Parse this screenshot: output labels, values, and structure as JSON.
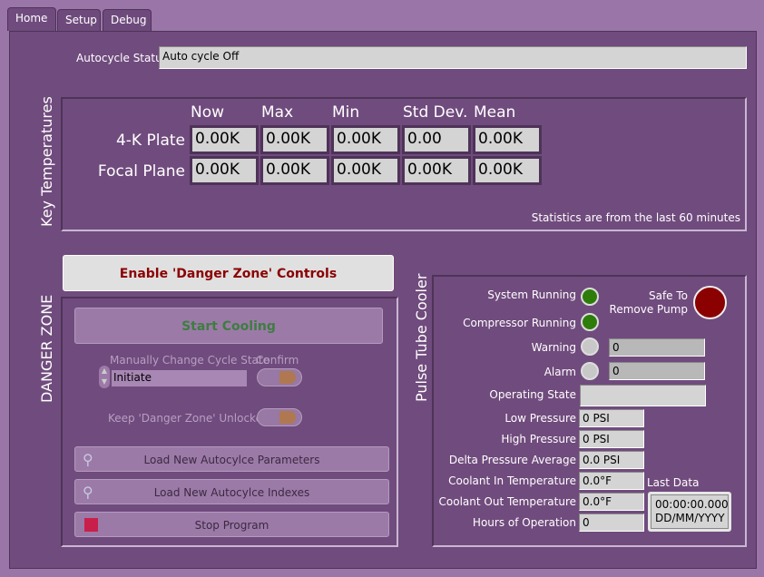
{
  "tabs": [
    {
      "label": "Home",
      "active": true
    },
    {
      "label": "Setup"
    },
    {
      "label": "Debug"
    }
  ],
  "autocycle": {
    "label": "Autocycle Status",
    "value": "Auto cycle Off"
  },
  "key_temps": {
    "title": "Key Temperatures",
    "columns": [
      "Now",
      "Max",
      "Min",
      "Std Dev.",
      "Mean"
    ],
    "rows": [
      {
        "label": "4-K Plate",
        "values": [
          "0.00K",
          "0.00K",
          "0.00K",
          "0.00",
          "0.00K"
        ]
      },
      {
        "label": "Focal Plane",
        "values": [
          "0.00K",
          "0.00K",
          "0.00K",
          "0.00K",
          "0.00K"
        ]
      }
    ],
    "note": "Statistics are from the last 60 minutes"
  },
  "danger": {
    "enable_label": "Enable 'Danger Zone' Controls",
    "title": "DANGER ZONE",
    "start_cooling": "Start Cooling",
    "cycle_state_label": "Manually Change Cycle State",
    "cycle_state_value": "Initiate",
    "confirm_label": "Confirm",
    "keep_unlocked_label": "Keep  'Danger Zone' Unlocked",
    "load_params": "Load New Autocylce Parameters",
    "load_indexes": "Load New Autocylce Indexes",
    "stop": "Stop Program"
  },
  "ptc": {
    "title": "Pulse Tube Cooler",
    "system_running": "System Running",
    "compressor_running": "Compressor Running",
    "safe_label_1": "Safe To",
    "safe_label_2": "Remove Pump",
    "warning": {
      "label": "Warning",
      "value": "0"
    },
    "alarm": {
      "label": "Alarm",
      "value": "0"
    },
    "operating_state": {
      "label": "Operating State",
      "value": ""
    },
    "readings": [
      {
        "label": "Low Pressure",
        "value": "0 PSI"
      },
      {
        "label": "High Pressure",
        "value": "0 PSI"
      },
      {
        "label": "Delta Pressure Average",
        "value": "0.0 PSI"
      },
      {
        "label": "Coolant In Temperature",
        "value": "0.0°F"
      },
      {
        "label": "Coolant Out Temperature",
        "value": "0.0°F"
      },
      {
        "label": "Hours of Operation",
        "value": "0"
      }
    ],
    "last_data": {
      "label": "Last Data",
      "time": "00:00:00.000",
      "date": "DD/MM/YYYY"
    },
    "colors": {
      "led_on": "#2e7d0a",
      "led_off": "#c8c8c8",
      "safe": "#8b0000"
    }
  }
}
